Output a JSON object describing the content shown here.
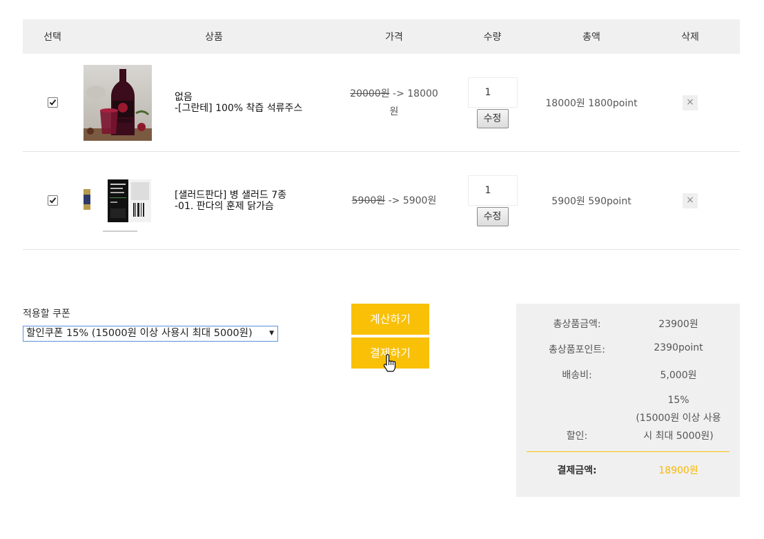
{
  "table": {
    "headers": {
      "select": "선택",
      "product": "상품",
      "price": "가격",
      "quantity": "수량",
      "total": "총액",
      "delete": "삭제"
    },
    "rows": [
      {
        "checked": true,
        "name_line1": "없음",
        "name_line2": "-[그란테] 100% 착즙 석류주스",
        "price_original": "20000원",
        "price_arrow_line1": " -> 18000",
        "price_arrow_line2": "원",
        "quantity": "1",
        "modify_label": "수정",
        "total": "18000원 1800point",
        "delete_label": "×"
      },
      {
        "checked": true,
        "name_line1": "[샐러드판다] 병 샐러드 7종",
        "name_line2": "-01. 판다의 훈제 닭가슴",
        "price_original": "5900원",
        "price_arrow_line1": " -> 5900원",
        "price_arrow_line2": "",
        "quantity": "1",
        "modify_label": "수정",
        "total": "5900원 590point",
        "delete_label": "×"
      }
    ]
  },
  "coupon": {
    "label": "적용할 쿠폰",
    "selected": "할인쿠폰 15% (15000원 이상 사용시 최대 5000원)"
  },
  "actions": {
    "calculate": "계산하기",
    "pay": "결제하기"
  },
  "summary": {
    "product_total_label": "총상품금액:",
    "product_total_value": "23900원",
    "points_label": "총상품포인트:",
    "points_value": "2390point",
    "shipping_label": "배송비:",
    "shipping_value": "5,000원",
    "discount_label": "할인:",
    "discount_line1": "15%",
    "discount_line2": "(15000원 이상 사용",
    "discount_line3": "시 최대 5000원)",
    "final_label": "결제금액:",
    "final_value": "18900원"
  },
  "colors": {
    "accent": "#f9c008",
    "header_bg": "#f0f0f0",
    "summary_bg": "#f0f0f0",
    "final_value": "#f9b700"
  }
}
